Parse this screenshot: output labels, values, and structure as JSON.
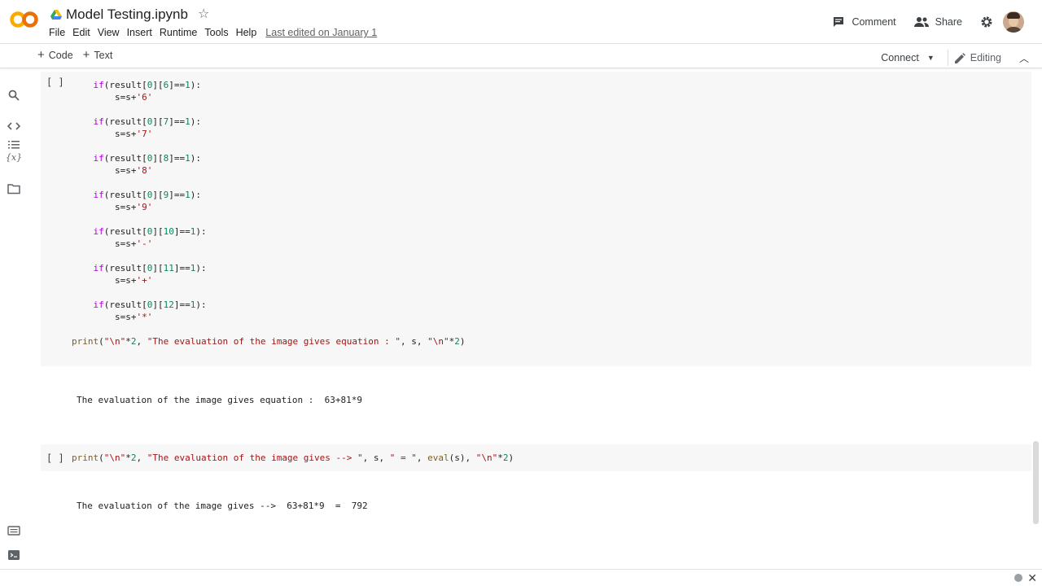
{
  "app": {
    "doc_title": "Model Testing.ipynb",
    "menu": [
      "File",
      "Edit",
      "View",
      "Insert",
      "Runtime",
      "Tools",
      "Help"
    ],
    "last_edited": "Last edited on January 1",
    "comment_label": "Comment",
    "share_label": "Share"
  },
  "toolbar": {
    "add_code": "Code",
    "add_text": "Text",
    "connect": "Connect",
    "editing": "Editing"
  },
  "rail_icons": [
    "table-of-contents-icon",
    "search-icon",
    "code-snippets-icon",
    "variables-icon",
    "files-icon",
    "command-palette-icon",
    "terminal-icon"
  ],
  "cells": [
    {
      "run_label": "[ ]",
      "lines": [
        "    if(result[0][6]==1):",
        "        s=s+'6'",
        "",
        "    if(result[0][7]==1):",
        "        s=s+'7'",
        "",
        "    if(result[0][8]==1):",
        "        s=s+'8'",
        "",
        "    if(result[0][9]==1):",
        "        s=s+'9'",
        "",
        "    if(result[0][10]==1):",
        "        s=s+'-'",
        "",
        "    if(result[0][11]==1):",
        "        s=s+'+'",
        "",
        "    if(result[0][12]==1):",
        "        s=s+'*'",
        "",
        "print(\"\\n\"*2, \"The evaluation of the image gives equation : \", s, \"\\n\"*2)"
      ],
      "output": "The evaluation of the image gives equation :  63+81*9"
    },
    {
      "run_label": "[ ]",
      "code": "print(\"\\n\"*2, \"The evaluation of the image gives --> \", s, \" = \", eval(s), \"\\n\"*2)",
      "output": "The evaluation of the image gives -->  63+81*9  =  792"
    }
  ]
}
